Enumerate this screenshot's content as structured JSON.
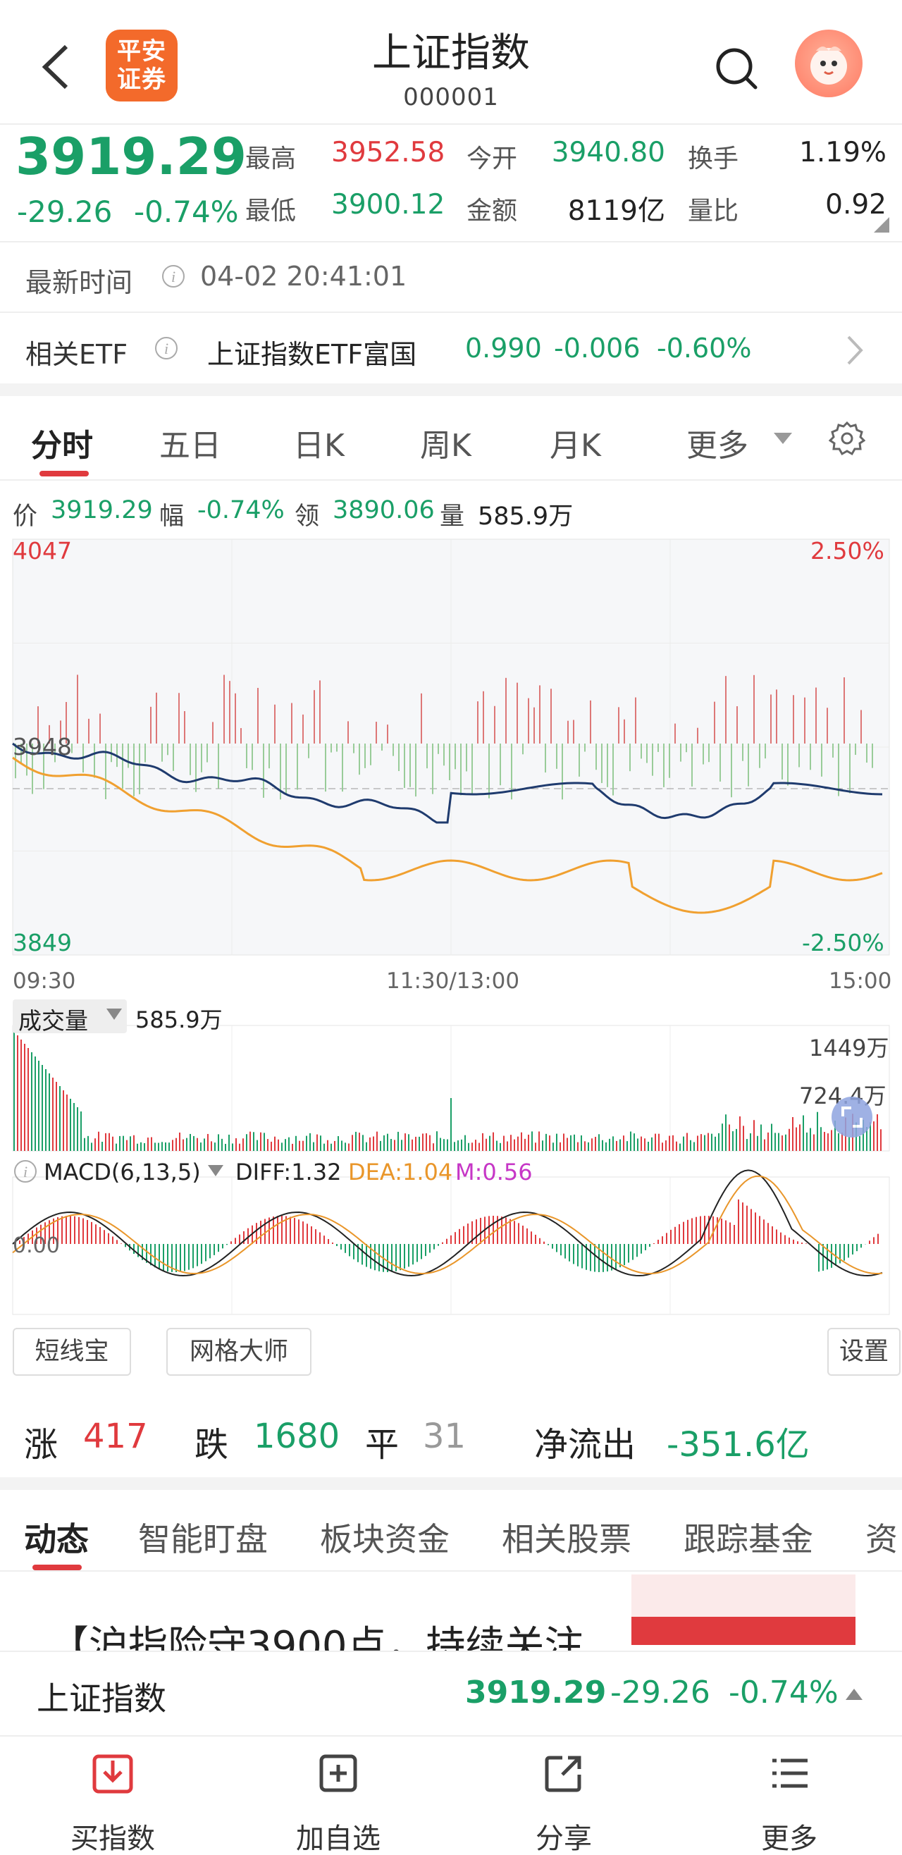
{
  "header": {
    "title": "上证指数",
    "code": "000001",
    "logo": "平安证券",
    "logo_l1": "平安",
    "logo_l2": "证券"
  },
  "quote": {
    "price": "3919.29",
    "change": "-29.26",
    "change_pct": "-0.74%",
    "high_label": "最高",
    "high": "3952.58",
    "low_label": "最低",
    "low": "3900.12",
    "open_label": "今开",
    "open": "3940.80",
    "amount_label": "金额",
    "amount": "8119亿",
    "turnover_label": "换手",
    "turnover": "1.19%",
    "vol_ratio_label": "量比",
    "vol_ratio": "0.92"
  },
  "update": {
    "label": "最新时间",
    "time": "04-02 20:41:01"
  },
  "etf": {
    "label": "相关ETF",
    "name": "上证指数ETF富国",
    "price": "0.990",
    "change": "-0.006",
    "pct": "-0.60%"
  },
  "tabs": {
    "t1": "分时",
    "t2": "五日",
    "t3": "日K",
    "t4": "周K",
    "t5": "月K",
    "more": "更多"
  },
  "info": {
    "price_l": "价",
    "price": "3919.29",
    "amp_l": "幅",
    "amp": "-0.74%",
    "lead_l": "领",
    "lead": "3890.06",
    "vol_l": "量",
    "vol": "585.9万"
  },
  "chart_labels": {
    "ymax": "4047",
    "ymin": "3849",
    "pmax": "2.50%",
    "pmin": "-2.50%",
    "mid": "3948",
    "t_start": "09:30",
    "t_mid": "11:30/13:00",
    "t_end": "15:00"
  },
  "volume": {
    "label": "成交量",
    "value": "585.9万",
    "max": "1449万",
    "half": "724.4万"
  },
  "macd": {
    "label": "MACD(6,13,5)",
    "diff": "DIFF:1.32",
    "dea": "DEA:1.04",
    "m": "M:0.56",
    "zero": "0.00"
  },
  "tools": {
    "t1": "短线宝",
    "t2": "网格大师",
    "settings": "设置"
  },
  "breadth": {
    "up_l": "涨",
    "up": "417",
    "down_l": "跌",
    "down": "1680",
    "flat_l": "平",
    "flat": "31",
    "flow_l": "净流出",
    "flow": "-351.6亿"
  },
  "bottom_tabs": {
    "b1": "动态",
    "b2": "智能盯盘",
    "b3": "板块资金",
    "b4": "相关股票",
    "b5": "跟踪基金",
    "b6": "资"
  },
  "news": {
    "headline": "【沪指险守3900点，持续关注"
  },
  "ticker": {
    "name": "上证指数",
    "price": "3919.29",
    "change": "-29.26",
    "pct": "-0.74%"
  },
  "nav": {
    "n1": "买指数",
    "n2": "加自选",
    "n3": "分享",
    "n4": "更多"
  },
  "colors": {
    "up": "#e03a3e",
    "down": "#1a9f67",
    "price_line": "#1f3b6e",
    "avg_line": "#f0a030",
    "macd_dea": "#e9962a",
    "macd_m": "#c636c6"
  }
}
